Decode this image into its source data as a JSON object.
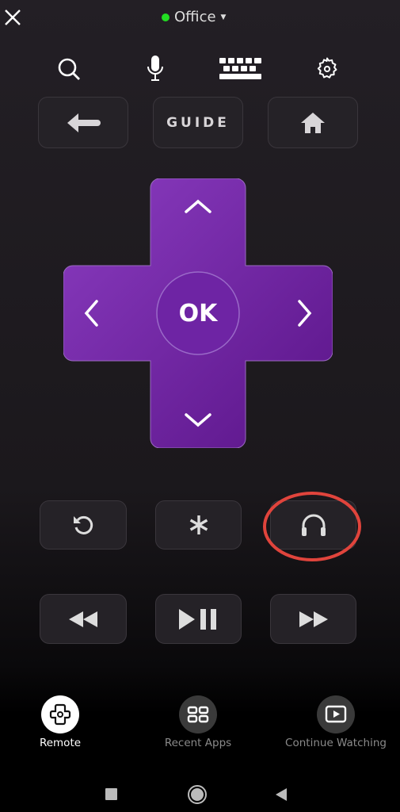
{
  "header": {
    "device_name": "Office",
    "status_color": "#22dd22"
  },
  "top_icons": [
    "search-icon",
    "microphone-icon",
    "keyboard-icon",
    "gear-icon"
  ],
  "row1": {
    "guide_label": "GUIDE"
  },
  "dpad": {
    "ok_label": "OK",
    "color": "#6a1d9a"
  },
  "highlight_color": "#e0443c",
  "bottom_nav": {
    "items": [
      {
        "label": "Remote",
        "active": true
      },
      {
        "label": "Recent Apps",
        "active": false
      },
      {
        "label": "Continue Watching",
        "active": false
      }
    ]
  }
}
